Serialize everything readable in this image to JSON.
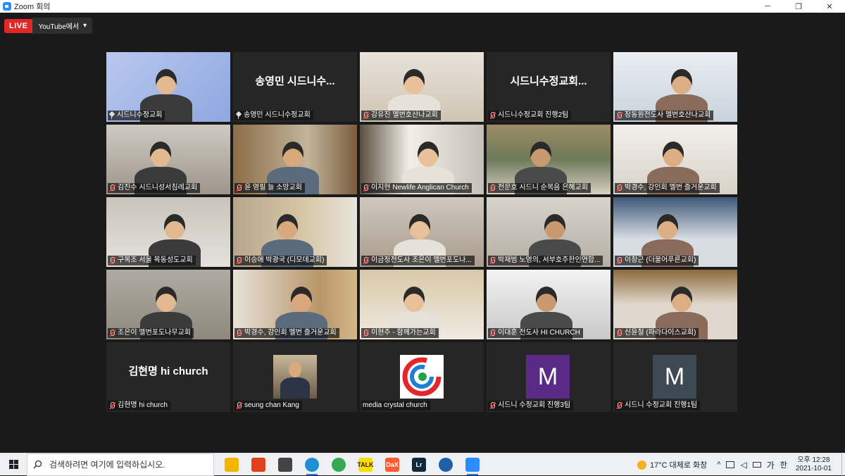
{
  "window": {
    "title": "Zoom 회의",
    "minimize": "─",
    "maximize": "❐",
    "close": "✕"
  },
  "live": {
    "badge": "LIVE",
    "destination": "YouTube에서",
    "caret": "▾"
  },
  "tiles": [
    {
      "label": "시드니수정교회",
      "icon": "pin",
      "kind": "video",
      "active": true
    },
    {
      "label": "송영민 시드니수정교회",
      "icon": "pin",
      "kind": "name",
      "big_name": "송영민 시드니수..."
    },
    {
      "label": "강유진 멜번호산나교회",
      "icon": "muted",
      "kind": "video"
    },
    {
      "label": "시드니수정교회 진행2팀",
      "icon": "muted",
      "kind": "name",
      "big_name": "시드니수정교회..."
    },
    {
      "label": "장동원전도사 멜번호산나교회",
      "icon": "muted",
      "kind": "video"
    },
    {
      "label": "김진수 시드니성서침례교회",
      "icon": "muted",
      "kind": "video"
    },
    {
      "label": "윤 영필 늘 소망교회",
      "icon": "muted",
      "kind": "video"
    },
    {
      "label": "이지현 Newlife Anglican Church",
      "icon": "muted",
      "kind": "video"
    },
    {
      "label": "전문호 시드니 순복음 은혜교회",
      "icon": "muted",
      "kind": "video"
    },
    {
      "label": "박경수, 강인회 멜번 즐거운교회",
      "icon": "muted",
      "kind": "video"
    },
    {
      "label": "구복조 서울 목동성도교회",
      "icon": "muted",
      "kind": "video"
    },
    {
      "label": "이승애 박광국 (디모데교회)",
      "icon": "muted",
      "kind": "video"
    },
    {
      "label": "이금정전도사 조은이 멜번포도나...",
      "icon": "muted",
      "kind": "video"
    },
    {
      "label": "박재범 노영의, 서부호주한인연합...",
      "icon": "muted",
      "kind": "video"
    },
    {
      "label": "이창근 (더불어푸른교회)",
      "icon": "muted",
      "kind": "video"
    },
    {
      "label": "조은이 멜번포도나무교회",
      "icon": "muted",
      "kind": "video"
    },
    {
      "label": "박경수, 강인회 멜번 즐거운교회",
      "icon": "muted",
      "kind": "video"
    },
    {
      "label": "이현주 - 함께가는교회",
      "icon": "muted",
      "kind": "video"
    },
    {
      "label": "이대훈 전도사 HI CHURCH",
      "icon": "muted",
      "kind": "video"
    },
    {
      "label": "신윤철 (파라다이스교회)",
      "icon": "muted",
      "kind": "video"
    },
    {
      "label": "김현명 hi church",
      "icon": "muted",
      "kind": "name",
      "big_name": "김현명 hi church"
    },
    {
      "label": "seung chan Kang",
      "icon": "muted",
      "kind": "photo"
    },
    {
      "label": "media crystal church",
      "icon": "none",
      "kind": "logo"
    },
    {
      "label": "시드니 수정교회 진행3팀",
      "icon": "muted",
      "kind": "avatar",
      "letter": "M",
      "color": "#5b2a86"
    },
    {
      "label": "시드니 수정교회 진행1팀",
      "icon": "muted",
      "kind": "avatar",
      "letter": "M",
      "color": "#3d4a55"
    }
  ],
  "taskbar": {
    "search_placeholder": "검색하려면 여기에 입력하십시오.",
    "apps": [
      {
        "name": "file-explorer",
        "glyph": "",
        "color": "#f2b600"
      },
      {
        "name": "office",
        "glyph": "",
        "color": "#e2421b"
      },
      {
        "name": "mail",
        "glyph": "",
        "color": "#444444"
      },
      {
        "name": "edge",
        "glyph": "",
        "color": "#1f8ed6"
      },
      {
        "name": "chrome",
        "glyph": "",
        "color": "#34a853"
      },
      {
        "name": "kakaotalk",
        "glyph": "TALK",
        "color": "#f7e000"
      },
      {
        "name": "daum",
        "glyph": "DaX",
        "color": "#ff5a2e"
      },
      {
        "name": "lightroom",
        "glyph": "Lr",
        "color": "#0f2a3f"
      },
      {
        "name": "obs",
        "glyph": "",
        "color": "#1f5fa8"
      },
      {
        "name": "zoom",
        "glyph": "",
        "color": "#2d8cff"
      }
    ],
    "weather": "17°C  대체로 화창",
    "tray_caret": "^",
    "ime_mode": "가",
    "ime_lang": "한",
    "time": "오후 12:28",
    "date": "2021-10-01"
  }
}
